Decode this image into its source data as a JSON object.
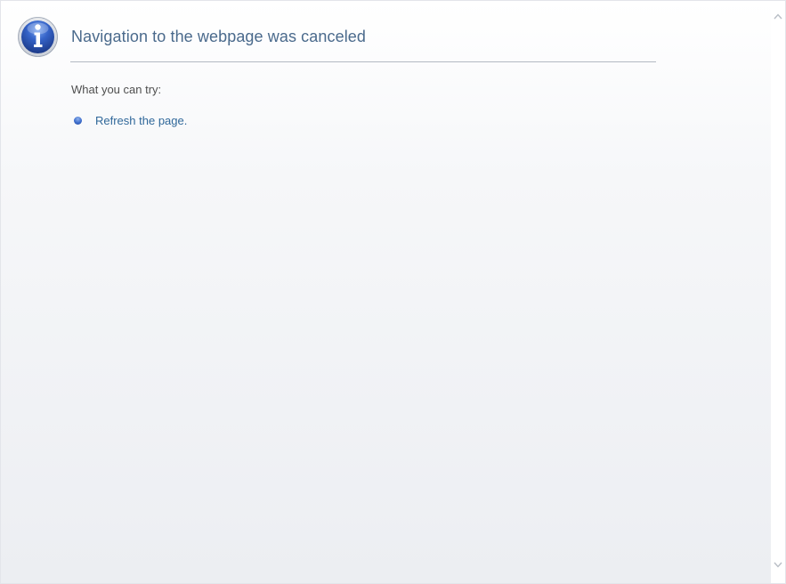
{
  "page": {
    "title": "Navigation to the webpage was canceled",
    "try_label": "What you can try:",
    "suggestions": [
      {
        "label": "Refresh the page."
      }
    ]
  },
  "icons": {
    "info": "info-icon",
    "bullet": "bullet-icon",
    "scroll_up": "chevron-up-icon",
    "scroll_down": "chevron-down-icon"
  },
  "colors": {
    "title": "#4a6a8c",
    "link": "#30689a",
    "icon_blue": "#2b52b8"
  }
}
